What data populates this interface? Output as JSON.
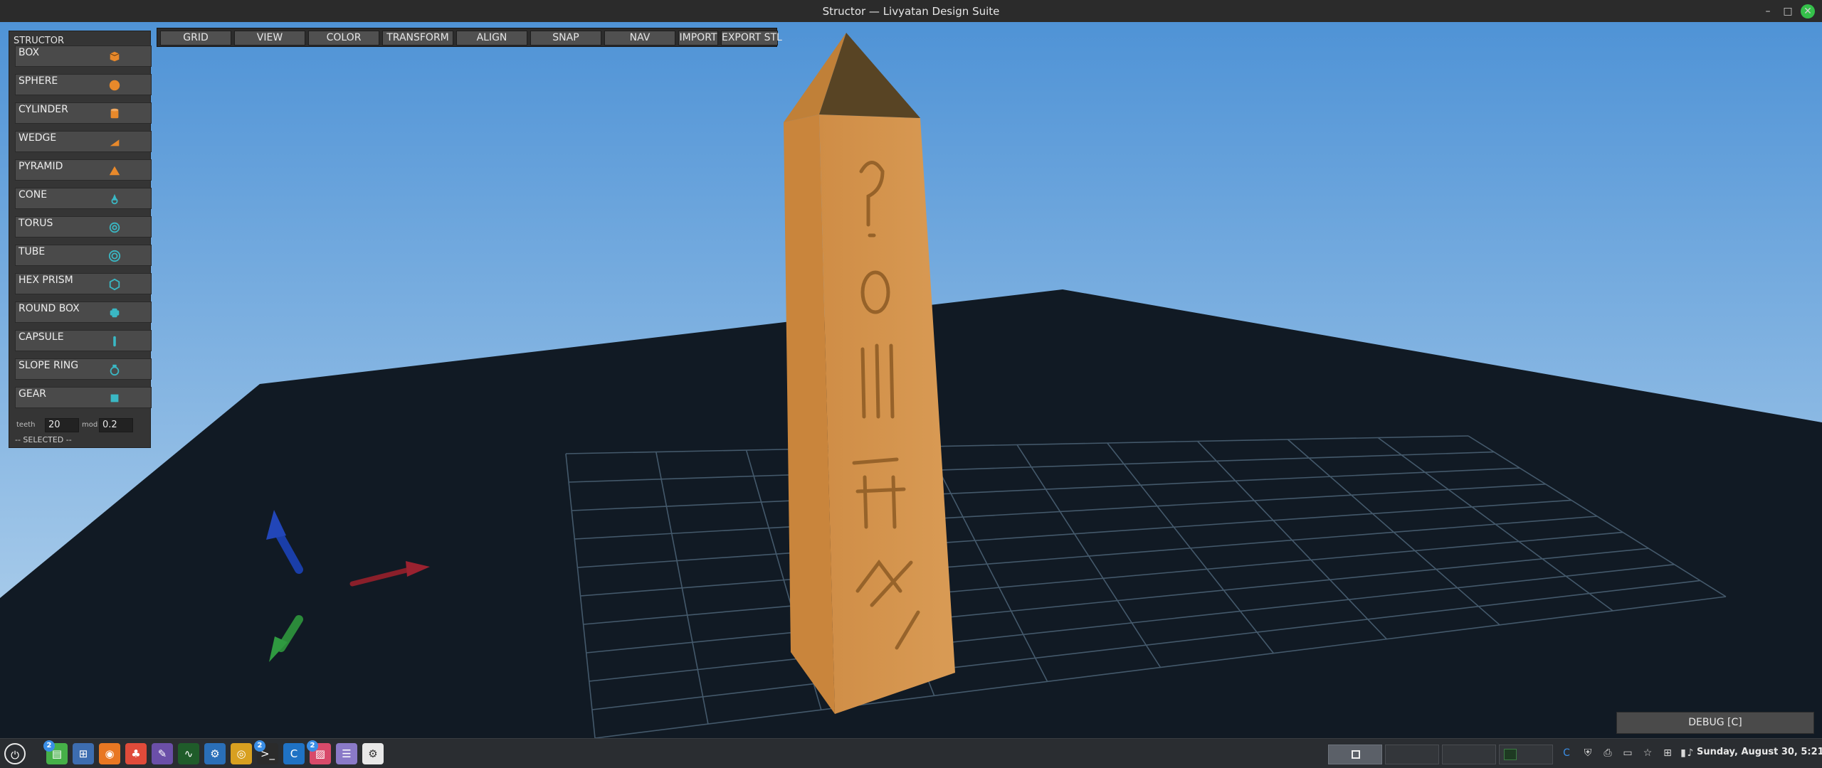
{
  "window": {
    "title": "Structor — Livyatan Design Suite",
    "minimize_glyph": "–",
    "maximize_glyph": "□",
    "close_glyph": "✕"
  },
  "structor_panel": {
    "title": "STRUCTOR",
    "items": [
      {
        "label": "BOX",
        "icon": "cube-icon",
        "color": "#e8892b"
      },
      {
        "label": "SPHERE",
        "icon": "sphere-icon",
        "color": "#e8892b"
      },
      {
        "label": "CYLINDER",
        "icon": "cylinder-icon",
        "color": "#e8892b"
      },
      {
        "label": "WEDGE",
        "icon": "wedge-icon",
        "color": "#e8892b"
      },
      {
        "label": "PYRAMID",
        "icon": "pyramid-icon",
        "color": "#e8892b"
      },
      {
        "label": "CONE",
        "icon": "cone-icon",
        "color": "#3ab8c4"
      },
      {
        "label": "TORUS",
        "icon": "torus-icon",
        "color": "#3ab8c4"
      },
      {
        "label": "TUBE",
        "icon": "tube-icon",
        "color": "#3ab8c4"
      },
      {
        "label": "HEX PRISM",
        "icon": "hex-prism-icon",
        "color": "#3ab8c4"
      },
      {
        "label": "ROUND BOX",
        "icon": "round-box-icon",
        "color": "#3ab8c4"
      },
      {
        "label": "CAPSULE",
        "icon": "capsule-icon",
        "color": "#3ab8c4"
      },
      {
        "label": "SLOPE RING",
        "icon": "slope-ring-icon",
        "color": "#3ab8c4"
      },
      {
        "label": "GEAR",
        "icon": "gear-icon",
        "color": "#3ab8c4"
      }
    ],
    "params": {
      "teeth_label": "teeth",
      "teeth_value": "20",
      "mod_label": "mod",
      "mod_value": "0.2"
    },
    "selected_label": "-- SELECTED --"
  },
  "toolbar": {
    "buttons": [
      "GRID",
      "VIEW",
      "COLOR",
      "TRANSFORM",
      "ALIGN",
      "SNAP",
      "NAV",
      "IMPORT",
      "EXPORT STL"
    ]
  },
  "viewport": {
    "sky_top": "#4f93d6",
    "sky_bottom": "#b9d6ee",
    "ground_color": "#111a24",
    "grid_color": "#4d6478",
    "obelisk_light": "#d89a52",
    "obelisk_dark": "#c9853c",
    "axis_colors": {
      "x": "#8a1f2a",
      "y": "#1a3ea8",
      "z": "#2b8a3a"
    }
  },
  "debug_button": "DEBUG [C]",
  "taskbar": {
    "apps": [
      {
        "icon": "start-menu-icon"
      },
      {
        "icon": "files-icon",
        "badge": "2"
      },
      {
        "icon": "calculator-icon"
      },
      {
        "icon": "blender-icon"
      },
      {
        "icon": "gitkraken-icon"
      },
      {
        "icon": "inkscape-icon"
      },
      {
        "icon": "system-monitor-icon"
      },
      {
        "icon": "steam-icon"
      },
      {
        "icon": "chrome-icon"
      },
      {
        "icon": "terminal-icon",
        "badge": "2"
      },
      {
        "icon": "ccleaner-icon"
      },
      {
        "icon": "image-viewer-icon",
        "badge": "2"
      },
      {
        "icon": "notes-icon"
      },
      {
        "icon": "settings-icon"
      }
    ],
    "clock": "Sunday, August 30, 5:21"
  }
}
